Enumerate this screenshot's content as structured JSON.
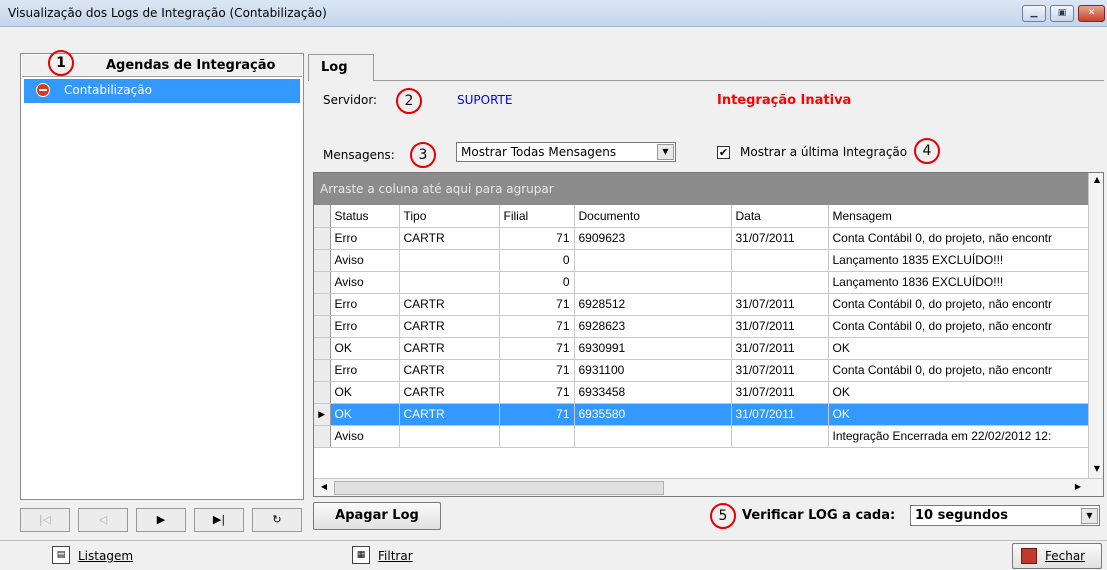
{
  "window": {
    "title": "Visualização dos Logs de Integração (Contabilização)",
    "controls": [
      "▁",
      "▣",
      "✕"
    ]
  },
  "left_panel": {
    "header": "Agendas de Integração",
    "items": [
      {
        "label": "Contabilização",
        "icon": "stop-icon"
      }
    ],
    "nav_buttons": [
      "|◁",
      "◁",
      "▶",
      "▶|",
      "↻"
    ]
  },
  "tabs": [
    {
      "label": "Log",
      "active": true
    }
  ],
  "servidor": {
    "label": "Servidor:",
    "value": "SUPORTE",
    "status": "Integração Inativa"
  },
  "mensagens": {
    "label": "Mensagens:",
    "selected": "Mostrar Todas Mensagens"
  },
  "show_last": {
    "label": "Mostrar a última Integração",
    "checked": true,
    "mark": "✔"
  },
  "markers": [
    "1",
    "2",
    "3",
    "4",
    "5"
  ],
  "grid": {
    "group_hint": "Arraste a coluna até aqui para agrupar",
    "columns": [
      "Status",
      "Tipo",
      "Filial",
      "Documento",
      "Data",
      "Mensagem"
    ],
    "rows": [
      [
        "Erro",
        "CARTR",
        "71",
        "6909623",
        "31/07/2011",
        "Conta Contábil 0, do projeto, não encontr"
      ],
      [
        "Aviso",
        "",
        "0",
        "",
        "",
        "Lançamento 1835 EXCLUÍDO!!!"
      ],
      [
        "Aviso",
        "",
        "0",
        "",
        "",
        "Lançamento 1836 EXCLUÍDO!!!"
      ],
      [
        "Erro",
        "CARTR",
        "71",
        "6928512",
        "31/07/2011",
        "Conta Contábil 0, do projeto, não encontr"
      ],
      [
        "Erro",
        "CARTR",
        "71",
        "6928623",
        "31/07/2011",
        "Conta Contábil 0, do projeto, não encontr"
      ],
      [
        "OK",
        "CARTR",
        "71",
        "6930991",
        "31/07/2011",
        "OK"
      ],
      [
        "Erro",
        "CARTR",
        "71",
        "6931100",
        "31/07/2011",
        "Conta Contábil 0, do projeto, não encontr"
      ],
      [
        "OK",
        "CARTR",
        "71",
        "6933458",
        "31/07/2011",
        "OK"
      ],
      [
        "OK",
        "CARTR",
        "71",
        "6935580",
        "31/07/2011",
        "OK"
      ],
      [
        "Aviso",
        "",
        "",
        "",
        "",
        "Integração Encerrada em 22/02/2012 12:"
      ]
    ],
    "selected_row": 8,
    "row_pointer": "▶"
  },
  "apagar_log": "Apagar Log",
  "verificar": {
    "label": "Verificar LOG a cada:",
    "selected": "10 segundos"
  },
  "statusbar": {
    "listagem": "Listagem",
    "filtrar": "Filtrar",
    "fechar": "Fechar"
  },
  "colors": {
    "selection": "#3399ff",
    "servidor_value": "#0000ff",
    "status_inactive": "#ff0000",
    "marker": "#e60000"
  }
}
